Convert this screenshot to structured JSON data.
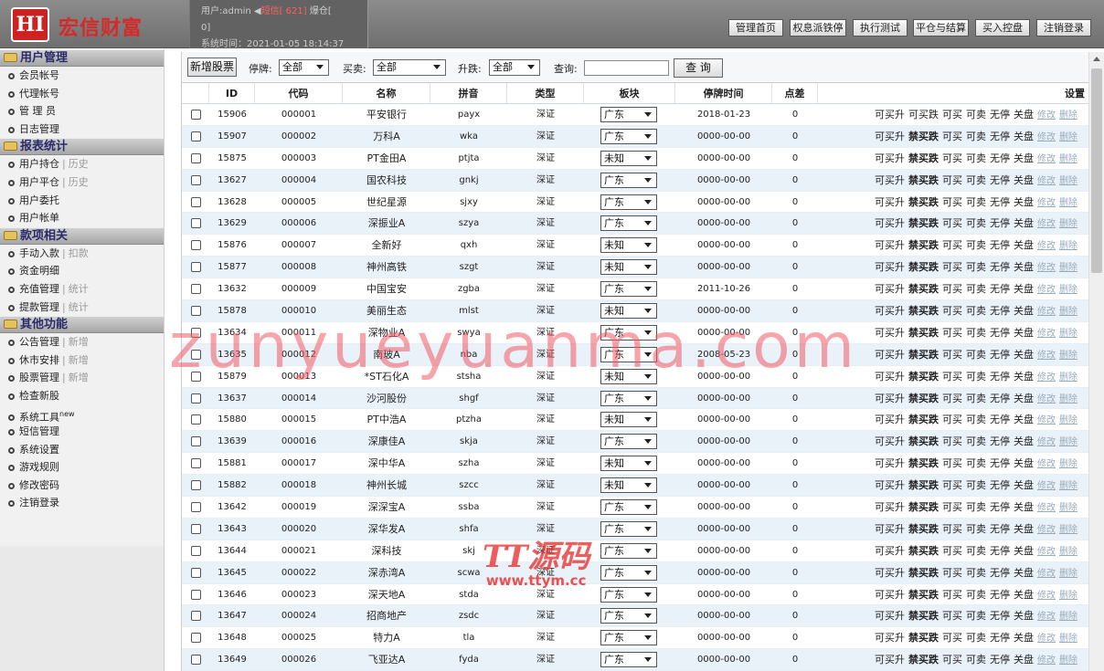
{
  "header": {
    "logo_text": "HI",
    "brand": "宏信财富",
    "user_label": "用户:admin",
    "sms_label": "短信[ 621]",
    "sms_suffix": "爆仓[",
    "sms_count": "0]",
    "time_label": "系统时间：2021-01-05 18:14:37",
    "buttons": [
      "管理首页",
      "权息派铁停",
      "执行测试",
      "平仓与结算",
      "买入控盘",
      "注销登录"
    ]
  },
  "sidebar": {
    "sections": [
      {
        "title": "用户管理",
        "items": [
          {
            "label": "会员帐号"
          },
          {
            "label": "代理帐号"
          },
          {
            "label": "管 理 员"
          },
          {
            "label": "日志管理"
          }
        ]
      },
      {
        "title": "报表统计",
        "items": [
          {
            "label": "用户持仓",
            "sub": "历史"
          },
          {
            "label": "用户平仓",
            "sub": "历史"
          },
          {
            "label": "用户委托"
          },
          {
            "label": "用户帐单"
          }
        ]
      },
      {
        "title": "款项相关",
        "items": [
          {
            "label": "手动入款",
            "sub": "扣款"
          },
          {
            "label": "资金明细"
          },
          {
            "label": "充值管理",
            "sub": "统计"
          },
          {
            "label": "提款管理",
            "sub": "统计"
          }
        ]
      },
      {
        "title": "其他功能",
        "items": [
          {
            "label": "公告管理",
            "sub": "新增"
          },
          {
            "label": "休市安排",
            "sub": "新增"
          },
          {
            "label": "股票管理",
            "sub": "新增"
          },
          {
            "label": "检查新股"
          },
          {
            "label": "系统工具",
            "sup": "new"
          },
          {
            "label": "短信管理"
          },
          {
            "label": "系统设置"
          },
          {
            "label": "游戏规则"
          },
          {
            "label": "修改密码"
          },
          {
            "label": "注销登录"
          }
        ]
      }
    ]
  },
  "toolbar": {
    "add_button": "新增股票",
    "suspend_label": "停牌:",
    "suspend_value": "全部",
    "trade_label": "买卖:",
    "trade_value": "全部",
    "change_label": "升跌:",
    "change_value": "全部",
    "query_label": "查询:",
    "query_value": "",
    "query_button": "查 询"
  },
  "table": {
    "headers": [
      "ID",
      "代码",
      "名称",
      "拼音",
      "类型",
      "板块",
      "停牌时间",
      "点差",
      "设置"
    ],
    "action_labels": [
      "可买升",
      "可买跌",
      "禁买跌",
      "可买",
      "可卖",
      "无停",
      "关盘",
      "修改",
      "删除"
    ],
    "rows": [
      [
        "15906",
        "000001",
        "平安银行",
        "payx",
        "深证",
        "广东",
        "2018-01-23",
        "0"
      ],
      [
        "15907",
        "000002",
        "万科A",
        "wka",
        "深证",
        "广东",
        "0000-00-00",
        "0"
      ],
      [
        "15875",
        "000003",
        "PT金田A",
        "ptjta",
        "深证",
        "未知",
        "0000-00-00",
        "0"
      ],
      [
        "13627",
        "000004",
        "国农科技",
        "gnkj",
        "深证",
        "广东",
        "0000-00-00",
        "0"
      ],
      [
        "13628",
        "000005",
        "世纪星源",
        "sjxy",
        "深证",
        "广东",
        "0000-00-00",
        "0"
      ],
      [
        "13629",
        "000006",
        "深振业A",
        "szya",
        "深证",
        "广东",
        "0000-00-00",
        "0"
      ],
      [
        "15876",
        "000007",
        "全新好",
        "qxh",
        "深证",
        "未知",
        "0000-00-00",
        "0"
      ],
      [
        "15877",
        "000008",
        "神州高铁",
        "szgt",
        "深证",
        "未知",
        "0000-00-00",
        "0"
      ],
      [
        "13632",
        "000009",
        "中国宝安",
        "zgba",
        "深证",
        "广东",
        "2011-10-26",
        "0"
      ],
      [
        "15878",
        "000010",
        "美丽生态",
        "mlst",
        "深证",
        "未知",
        "0000-00-00",
        "0"
      ],
      [
        "13634",
        "000011",
        "深物业A",
        "swya",
        "深证",
        "广东",
        "0000-00-00",
        "0"
      ],
      [
        "13635",
        "000012",
        "南玻A",
        "nba",
        "深证",
        "广东",
        "2008-05-23",
        "0"
      ],
      [
        "15879",
        "000013",
        "*ST石化A",
        "stsha",
        "深证",
        "未知",
        "0000-00-00",
        "0"
      ],
      [
        "13637",
        "000014",
        "沙河股份",
        "shgf",
        "深证",
        "广东",
        "0000-00-00",
        "0"
      ],
      [
        "15880",
        "000015",
        "PT中浩A",
        "ptzha",
        "深证",
        "未知",
        "0000-00-00",
        "0"
      ],
      [
        "13639",
        "000016",
        "深康佳A",
        "skja",
        "深证",
        "广东",
        "0000-00-00",
        "0"
      ],
      [
        "15881",
        "000017",
        "深中华A",
        "szha",
        "深证",
        "未知",
        "0000-00-00",
        "0"
      ],
      [
        "15882",
        "000018",
        "神州长城",
        "szcc",
        "深证",
        "未知",
        "0000-00-00",
        "0"
      ],
      [
        "13642",
        "000019",
        "深深宝A",
        "ssba",
        "深证",
        "广东",
        "0000-00-00",
        "0"
      ],
      [
        "13643",
        "000020",
        "深华发A",
        "shfa",
        "深证",
        "广东",
        "0000-00-00",
        "0"
      ],
      [
        "13644",
        "000021",
        "深科技",
        "skj",
        "深证",
        "广东",
        "0000-00-00",
        "0"
      ],
      [
        "13645",
        "000022",
        "深赤湾A",
        "scwa",
        "深证",
        "广东",
        "0000-00-00",
        "0"
      ],
      [
        "13646",
        "000023",
        "深天地A",
        "stda",
        "深证",
        "广东",
        "0000-00-00",
        "0"
      ],
      [
        "13647",
        "000024",
        "招商地产",
        "zsdc",
        "深证",
        "广东",
        "0000-00-00",
        "0"
      ],
      [
        "13648",
        "000025",
        "特力A",
        "tla",
        "深证",
        "广东",
        "0000-00-00",
        "0"
      ],
      [
        "13649",
        "000026",
        "飞亚达A",
        "fyda",
        "深证",
        "广东",
        "0000-00-00",
        "0"
      ]
    ]
  },
  "watermark": {
    "main": "zunyueyuanma.com",
    "brand_top": "TT源码",
    "brand_url": "www.ttym.cc"
  }
}
